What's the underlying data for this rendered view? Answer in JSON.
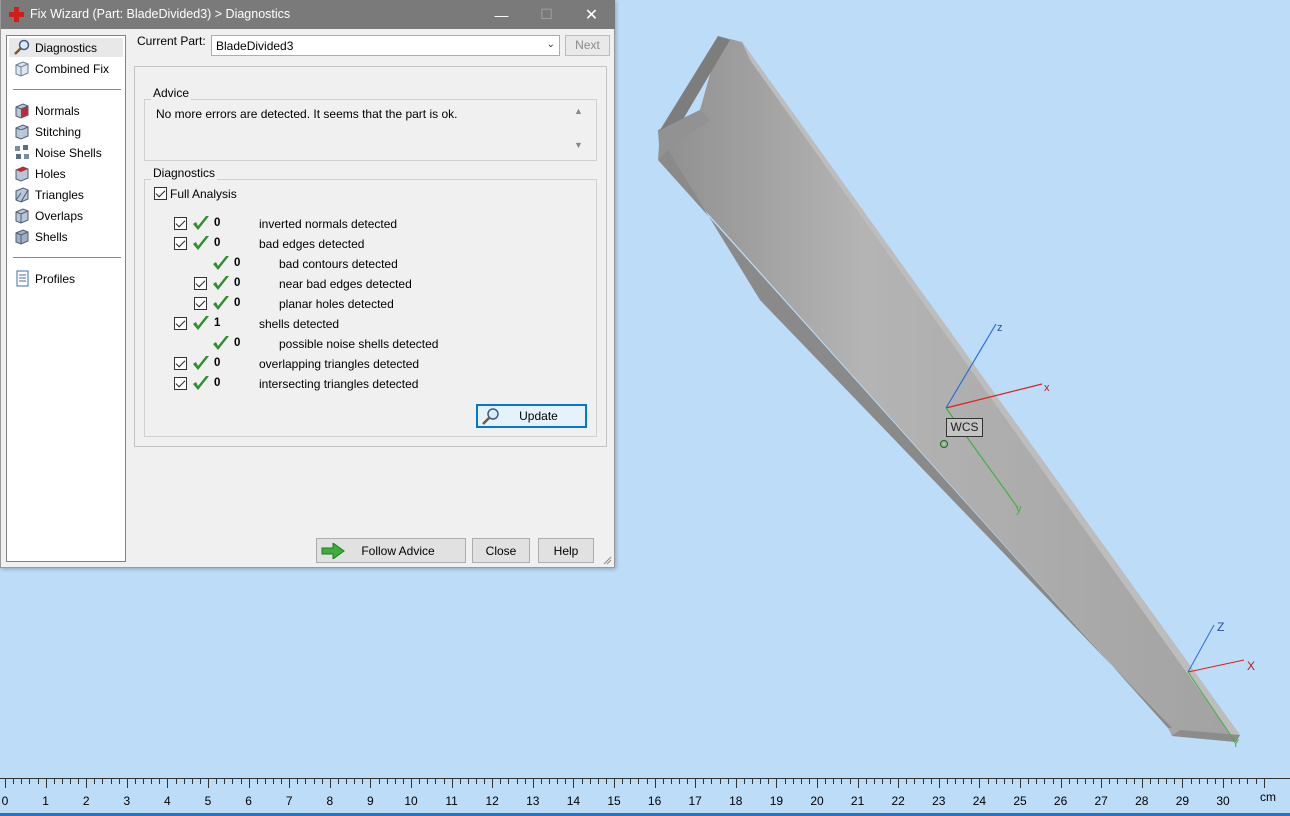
{
  "window": {
    "title": "Fix Wizard (Part: BladeDivided3) > Diagnostics",
    "minimize": "—",
    "maximize": "☐",
    "close": "✕"
  },
  "sidebar": {
    "items": [
      {
        "label": "Diagnostics",
        "icon": "magnifier-icon"
      },
      {
        "label": "Combined Fix",
        "icon": "cube-icon"
      },
      {
        "label": "Normals",
        "icon": "normals-cube-icon"
      },
      {
        "label": "Stitching",
        "icon": "stitching-cube-icon"
      },
      {
        "label": "Noise Shells",
        "icon": "noise-shells-icon"
      },
      {
        "label": "Holes",
        "icon": "holes-cube-icon"
      },
      {
        "label": "Triangles",
        "icon": "triangles-cube-icon"
      },
      {
        "label": "Overlaps",
        "icon": "overlaps-cube-icon"
      },
      {
        "label": "Shells",
        "icon": "shells-cube-icon"
      },
      {
        "label": "Profiles",
        "icon": "document-icon"
      }
    ],
    "selected": "Diagnostics"
  },
  "current_part": {
    "label": "Current Part:",
    "value": "BladeDivided3",
    "next_label": "Next"
  },
  "advice": {
    "title": "Advice",
    "text": "No more errors are detected. It seems that the part is ok."
  },
  "diagnostics": {
    "title": "Diagnostics",
    "full_analysis_label": "Full Analysis",
    "full_analysis_checked": true,
    "rows": [
      {
        "count": "0",
        "label": "inverted normals detected",
        "level": 0,
        "checkbox": true
      },
      {
        "count": "0",
        "label": "bad edges detected",
        "level": 0,
        "checkbox": true
      },
      {
        "count": "0",
        "label": "bad contours detected",
        "level": 1,
        "checkbox": false
      },
      {
        "count": "0",
        "label": "near bad edges detected",
        "level": 1,
        "checkbox": true
      },
      {
        "count": "0",
        "label": "planar holes detected",
        "level": 1,
        "checkbox": true
      },
      {
        "count": "1",
        "label": "shells detected",
        "level": 0,
        "checkbox": true
      },
      {
        "count": "0",
        "label": "possible noise shells detected",
        "level": 1,
        "checkbox": false
      },
      {
        "count": "0",
        "label": "overlapping triangles detected",
        "level": 0,
        "checkbox": true
      },
      {
        "count": "0",
        "label": "intersecting triangles detected",
        "level": 0,
        "checkbox": true
      }
    ],
    "update_label": "Update"
  },
  "buttons": {
    "follow_advice": "Follow Advice",
    "close": "Close",
    "help": "Help"
  },
  "viewport": {
    "wcs_label": "WCS",
    "axis_labels": {
      "x": "x",
      "y": "y",
      "z": "z"
    },
    "mini_axis_labels": {
      "x": "X",
      "y": "Y",
      "z": "Z"
    },
    "colors": {
      "x": "#e02020",
      "y": "#3cb43c",
      "z": "#2a6fd6",
      "background": "#bcdcf8",
      "part": "#a8a8a8"
    }
  },
  "ruler": {
    "labels": [
      "0",
      "1",
      "2",
      "3",
      "4",
      "5",
      "6",
      "7",
      "8",
      "9",
      "10",
      "11",
      "12",
      "13",
      "14",
      "15",
      "16",
      "17",
      "18",
      "19",
      "20",
      "21",
      "22",
      "23",
      "24",
      "25",
      "26",
      "27",
      "28",
      "29",
      "30"
    ],
    "unit": "cm"
  }
}
